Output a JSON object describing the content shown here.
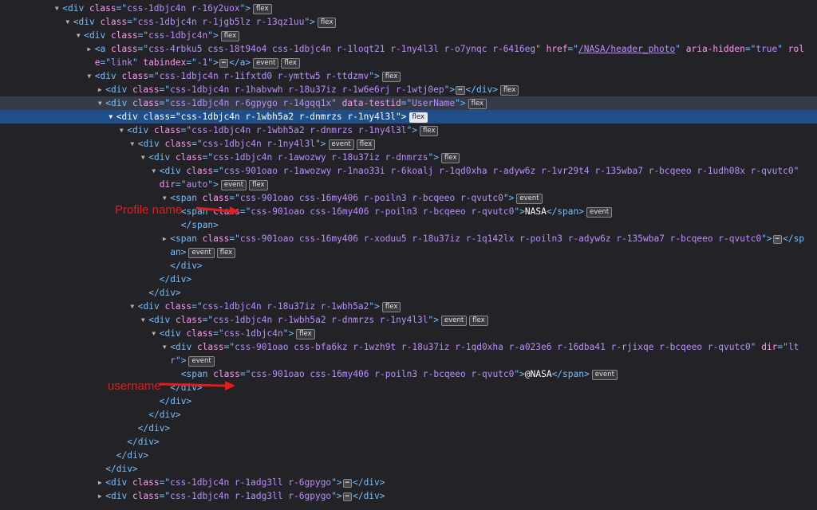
{
  "inspector": {
    "badges": {
      "flex": "flex",
      "event": "event"
    },
    "ellipsis": "⋯",
    "selected_row": 7,
    "hover_row": 6,
    "guide": {
      "from_row": 8,
      "to_row": 34
    },
    "rows": [
      {
        "indent": 11,
        "expand": "open",
        "parts": [
          {
            "t": "tag",
            "v": "<div "
          },
          {
            "t": "attr-name",
            "v": "class"
          },
          {
            "t": "tag",
            "v": "=\""
          },
          {
            "t": "attr-value",
            "v": "css-1dbjc4n r-16y2uox"
          },
          {
            "t": "tag",
            "v": "\">"
          }
        ],
        "badges": [
          "flex"
        ]
      },
      {
        "indent": 13,
        "expand": "open",
        "parts": [
          {
            "t": "tag",
            "v": "<div "
          },
          {
            "t": "attr-name",
            "v": "class"
          },
          {
            "t": "tag",
            "v": "=\""
          },
          {
            "t": "attr-value",
            "v": "css-1dbjc4n r-1jgb5lz r-13qz1uu"
          },
          {
            "t": "tag",
            "v": "\">"
          }
        ],
        "badges": [
          "flex"
        ]
      },
      {
        "indent": 15,
        "expand": "open",
        "parts": [
          {
            "t": "tag",
            "v": "<div "
          },
          {
            "t": "attr-name",
            "v": "class"
          },
          {
            "t": "tag",
            "v": "=\""
          },
          {
            "t": "attr-value",
            "v": "css-1dbjc4n"
          },
          {
            "t": "tag",
            "v": "\">"
          }
        ],
        "badges": [
          "flex"
        ]
      },
      {
        "indent": 17,
        "expand": "closed",
        "tall": true,
        "parts": [
          {
            "t": "tag",
            "v": "<a "
          },
          {
            "t": "attr-name",
            "v": "class"
          },
          {
            "t": "tag",
            "v": "=\""
          },
          {
            "t": "attr-value",
            "v": "css-4rbku5 css-18t94o4 css-1dbjc4n r-1loqt21 r-1ny4l3l r-o7ynqc r-6416eg"
          },
          {
            "t": "tag",
            "v": "\" "
          },
          {
            "t": "attr-name",
            "v": "href"
          },
          {
            "t": "tag",
            "v": "=\""
          },
          {
            "t": "attr-value link",
            "v": "/NASA/header_photo"
          },
          {
            "t": "tag",
            "v": "\" "
          },
          {
            "t": "attr-name",
            "v": "aria-hidden"
          },
          {
            "t": "tag",
            "v": "=\""
          },
          {
            "t": "attr-value",
            "v": "true"
          },
          {
            "t": "tag",
            "v": "\" "
          },
          {
            "t": "attr-name",
            "v": "role"
          },
          {
            "t": "tag",
            "v": "=\""
          },
          {
            "t": "attr-value",
            "v": "link"
          },
          {
            "t": "tag",
            "v": "\" "
          },
          {
            "t": "attr-name",
            "v": "tabindex"
          },
          {
            "t": "tag",
            "v": "=\""
          },
          {
            "t": "attr-value",
            "v": "-1"
          },
          {
            "t": "tag",
            "v": "\">"
          },
          {
            "t": "ellipsis"
          },
          {
            "t": "tag",
            "v": "</a>"
          }
        ],
        "badges": [
          "event",
          "flex"
        ]
      },
      {
        "indent": 17,
        "expand": "open",
        "parts": [
          {
            "t": "tag",
            "v": "<div "
          },
          {
            "t": "attr-name",
            "v": "class"
          },
          {
            "t": "tag",
            "v": "=\""
          },
          {
            "t": "attr-value",
            "v": "css-1dbjc4n r-1ifxtd0 r-ymttw5 r-ttdzmv"
          },
          {
            "t": "tag",
            "v": "\">"
          }
        ],
        "badges": [
          "flex"
        ]
      },
      {
        "indent": 19,
        "expand": "closed",
        "parts": [
          {
            "t": "tag",
            "v": "<div "
          },
          {
            "t": "attr-name",
            "v": "class"
          },
          {
            "t": "tag",
            "v": "=\""
          },
          {
            "t": "attr-value",
            "v": "css-1dbjc4n r-1habvwh r-18u37iz r-1w6e6rj r-1wtj0ep"
          },
          {
            "t": "tag",
            "v": "\">"
          },
          {
            "t": "ellipsis"
          },
          {
            "t": "tag",
            "v": "</div>"
          }
        ],
        "badges": [
          "flex"
        ]
      },
      {
        "indent": 19,
        "expand": "open",
        "parts": [
          {
            "t": "tag",
            "v": "<div "
          },
          {
            "t": "attr-name",
            "v": "class"
          },
          {
            "t": "tag",
            "v": "=\""
          },
          {
            "t": "attr-value",
            "v": "css-1dbjc4n r-6gpygo r-14gqq1x"
          },
          {
            "t": "tag",
            "v": "\" "
          },
          {
            "t": "attr-name",
            "v": "data-testid"
          },
          {
            "t": "tag",
            "v": "=\""
          },
          {
            "t": "attr-value",
            "v": "UserName"
          },
          {
            "t": "tag",
            "v": "\">"
          }
        ],
        "badges": [
          "flex"
        ]
      },
      {
        "indent": 21,
        "expand": "open",
        "parts": [
          {
            "t": "tag",
            "v": "<div "
          },
          {
            "t": "attr-name",
            "v": "class"
          },
          {
            "t": "tag",
            "v": "=\""
          },
          {
            "t": "attr-value",
            "v": "css-1dbjc4n r-1wbh5a2 r-dnmrzs r-1ny4l3l"
          },
          {
            "t": "tag",
            "v": "\">"
          }
        ],
        "badges": [
          "flex"
        ]
      },
      {
        "indent": 23,
        "expand": "open",
        "parts": [
          {
            "t": "tag",
            "v": "<div "
          },
          {
            "t": "attr-name",
            "v": "class"
          },
          {
            "t": "tag",
            "v": "=\""
          },
          {
            "t": "attr-value",
            "v": "css-1dbjc4n r-1wbh5a2 r-dnmrzs r-1ny4l3l"
          },
          {
            "t": "tag",
            "v": "\">"
          }
        ],
        "badges": [
          "flex"
        ]
      },
      {
        "indent": 25,
        "expand": "open",
        "parts": [
          {
            "t": "tag",
            "v": "<div "
          },
          {
            "t": "attr-name",
            "v": "class"
          },
          {
            "t": "tag",
            "v": "=\""
          },
          {
            "t": "attr-value",
            "v": "css-1dbjc4n r-1ny4l3l"
          },
          {
            "t": "tag",
            "v": "\">"
          }
        ],
        "badges": [
          "event",
          "flex"
        ]
      },
      {
        "indent": 27,
        "expand": "open",
        "parts": [
          {
            "t": "tag",
            "v": "<div "
          },
          {
            "t": "attr-name",
            "v": "class"
          },
          {
            "t": "tag",
            "v": "=\""
          },
          {
            "t": "attr-value",
            "v": "css-1dbjc4n r-1awozwy r-18u37iz r-dnmrzs"
          },
          {
            "t": "tag",
            "v": "\">"
          }
        ],
        "badges": [
          "flex"
        ]
      },
      {
        "indent": 29,
        "expand": "open",
        "tall": true,
        "parts": [
          {
            "t": "tag",
            "v": "<div "
          },
          {
            "t": "attr-name",
            "v": "class"
          },
          {
            "t": "tag",
            "v": "=\""
          },
          {
            "t": "attr-value",
            "v": "css-901oao r-1awozwy r-1nao33i r-6koalj r-1qd0xha r-adyw6z r-1vr29t4 r-135wba7 r-bcqeeo r-1udh08x r-qvutc0"
          },
          {
            "t": "tag",
            "v": "\" "
          },
          {
            "t": "attr-name",
            "v": "dir"
          },
          {
            "t": "tag",
            "v": "=\""
          },
          {
            "t": "attr-value",
            "v": "auto"
          },
          {
            "t": "tag",
            "v": "\">"
          }
        ],
        "badges": [
          "event",
          "flex"
        ]
      },
      {
        "indent": 31,
        "expand": "open",
        "parts": [
          {
            "t": "tag",
            "v": "<span "
          },
          {
            "t": "attr-name",
            "v": "class"
          },
          {
            "t": "tag",
            "v": "=\""
          },
          {
            "t": "attr-value",
            "v": "css-901oao css-16my406 r-poiln3 r-bcqeeo r-qvutc0"
          },
          {
            "t": "tag",
            "v": "\">"
          }
        ],
        "badges": [
          "event"
        ]
      },
      {
        "indent": 33,
        "expand": "none",
        "parts": [
          {
            "t": "tag",
            "v": "<span "
          },
          {
            "t": "attr-name",
            "v": "class"
          },
          {
            "t": "tag",
            "v": "=\""
          },
          {
            "t": "attr-value",
            "v": "css-901oao css-16my406 r-poiln3 r-bcqeeo r-qvutc0"
          },
          {
            "t": "tag",
            "v": "\">"
          },
          {
            "t": "text",
            "v": "NASA"
          },
          {
            "t": "tag",
            "v": "</span>"
          }
        ],
        "badges": [
          "event"
        ]
      },
      {
        "indent": 33,
        "expand": "none",
        "parts": [
          {
            "t": "tag",
            "v": "</span>"
          }
        ],
        "badges": []
      },
      {
        "indent": 31,
        "expand": "closed",
        "tall": true,
        "parts": [
          {
            "t": "tag",
            "v": "<span "
          },
          {
            "t": "attr-name",
            "v": "class"
          },
          {
            "t": "tag",
            "v": "=\""
          },
          {
            "t": "attr-value",
            "v": "css-901oao css-16my406 r-xoduu5 r-18u37iz r-1q142lx r-poiln3 r-adyw6z r-135wba7 r-bcqeeo r-qvutc0"
          },
          {
            "t": "tag",
            "v": "\">"
          },
          {
            "t": "ellipsis"
          },
          {
            "t": "tag",
            "v": "</span>"
          }
        ],
        "badges": [
          "event",
          "flex"
        ]
      },
      {
        "indent": 31,
        "expand": "none",
        "parts": [
          {
            "t": "tag",
            "v": "</div>"
          }
        ],
        "badges": []
      },
      {
        "indent": 29,
        "expand": "none",
        "parts": [
          {
            "t": "tag",
            "v": "</div>"
          }
        ],
        "badges": []
      },
      {
        "indent": 27,
        "expand": "none",
        "parts": [
          {
            "t": "tag",
            "v": "</div>"
          }
        ],
        "badges": []
      },
      {
        "indent": 25,
        "expand": "open",
        "parts": [
          {
            "t": "tag",
            "v": "<div "
          },
          {
            "t": "attr-name",
            "v": "class"
          },
          {
            "t": "tag",
            "v": "=\""
          },
          {
            "t": "attr-value",
            "v": "css-1dbjc4n r-18u37iz r-1wbh5a2"
          },
          {
            "t": "tag",
            "v": "\">"
          }
        ],
        "badges": [
          "flex"
        ]
      },
      {
        "indent": 27,
        "expand": "open",
        "parts": [
          {
            "t": "tag",
            "v": "<div "
          },
          {
            "t": "attr-name",
            "v": "class"
          },
          {
            "t": "tag",
            "v": "=\""
          },
          {
            "t": "attr-value",
            "v": "css-1dbjc4n r-1wbh5a2 r-dnmrzs r-1ny4l3l"
          },
          {
            "t": "tag",
            "v": "\">"
          }
        ],
        "badges": [
          "event",
          "flex"
        ]
      },
      {
        "indent": 29,
        "expand": "open",
        "parts": [
          {
            "t": "tag",
            "v": "<div "
          },
          {
            "t": "attr-name",
            "v": "class"
          },
          {
            "t": "tag",
            "v": "=\""
          },
          {
            "t": "attr-value",
            "v": "css-1dbjc4n"
          },
          {
            "t": "tag",
            "v": "\">"
          }
        ],
        "badges": [
          "flex"
        ]
      },
      {
        "indent": 31,
        "expand": "open",
        "tall": true,
        "parts": [
          {
            "t": "tag",
            "v": "<div "
          },
          {
            "t": "attr-name",
            "v": "class"
          },
          {
            "t": "tag",
            "v": "=\""
          },
          {
            "t": "attr-value",
            "v": "css-901oao css-bfa6kz r-1wzh9t r-18u37iz r-1qd0xha r-a023e6 r-16dba41 r-rjixqe r-bcqeeo r-qvutc0"
          },
          {
            "t": "tag",
            "v": "\" "
          },
          {
            "t": "attr-name",
            "v": "dir"
          },
          {
            "t": "tag",
            "v": "=\""
          },
          {
            "t": "attr-value",
            "v": "ltr"
          },
          {
            "t": "tag",
            "v": "\">"
          }
        ],
        "badges": [
          "event"
        ]
      },
      {
        "indent": 33,
        "expand": "none",
        "parts": [
          {
            "t": "tag",
            "v": "<span "
          },
          {
            "t": "attr-name",
            "v": "class"
          },
          {
            "t": "tag",
            "v": "=\""
          },
          {
            "t": "attr-value",
            "v": "css-901oao css-16my406 r-poiln3 r-bcqeeo r-qvutc0"
          },
          {
            "t": "tag",
            "v": "\">"
          },
          {
            "t": "text",
            "v": "@NASA"
          },
          {
            "t": "tag",
            "v": "</span>"
          }
        ],
        "badges": [
          "event"
        ]
      },
      {
        "indent": 31,
        "expand": "none",
        "parts": [
          {
            "t": "tag",
            "v": "</div>"
          }
        ],
        "badges": []
      },
      {
        "indent": 29,
        "expand": "none",
        "parts": [
          {
            "t": "tag",
            "v": "</div>"
          }
        ],
        "badges": []
      },
      {
        "indent": 27,
        "expand": "none",
        "parts": [
          {
            "t": "tag",
            "v": "</div>"
          }
        ],
        "badges": []
      },
      {
        "indent": 25,
        "expand": "none",
        "parts": [
          {
            "t": "tag",
            "v": "</div>"
          }
        ],
        "badges": []
      },
      {
        "indent": 23,
        "expand": "none",
        "parts": [
          {
            "t": "tag",
            "v": "</div>"
          }
        ],
        "badges": []
      },
      {
        "indent": 21,
        "expand": "none",
        "parts": [
          {
            "t": "tag",
            "v": "</div>"
          }
        ],
        "badges": []
      },
      {
        "indent": 19,
        "expand": "none",
        "parts": [
          {
            "t": "tag",
            "v": "</div>"
          }
        ],
        "badges": []
      },
      {
        "indent": 19,
        "expand": "closed",
        "parts": [
          {
            "t": "tag",
            "v": "<div "
          },
          {
            "t": "attr-name",
            "v": "class"
          },
          {
            "t": "tag",
            "v": "=\""
          },
          {
            "t": "attr-value",
            "v": "css-1dbjc4n r-1adg3ll r-6gpygo"
          },
          {
            "t": "tag",
            "v": "\">"
          },
          {
            "t": "ellipsis"
          },
          {
            "t": "tag",
            "v": "</div>"
          }
        ],
        "badges": []
      },
      {
        "indent": 19,
        "expand": "closed",
        "parts": [
          {
            "t": "tag",
            "v": "<div "
          },
          {
            "t": "attr-name",
            "v": "class"
          },
          {
            "t": "tag",
            "v": "=\""
          },
          {
            "t": "attr-value",
            "v": "css-1dbjc4n r-1adg3ll r-6gpygo"
          },
          {
            "t": "tag",
            "v": "\">"
          },
          {
            "t": "ellipsis"
          },
          {
            "t": "tag",
            "v": "</div>"
          }
        ],
        "badges": []
      }
    ]
  },
  "annotations": {
    "profile_name": {
      "label": "Profile name",
      "target_row": 13,
      "color": "#e11d1d"
    },
    "username": {
      "label": "username",
      "target_row": 24,
      "color": "#e11d1d"
    }
  }
}
